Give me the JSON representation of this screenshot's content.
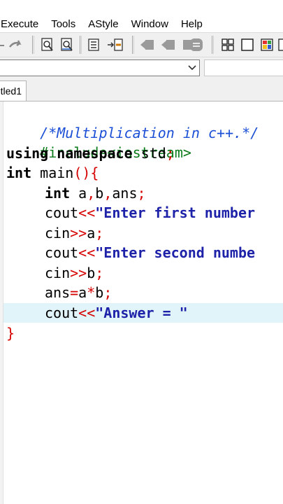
{
  "menu": [
    "Execute",
    "Tools",
    "AStyle",
    "Window",
    "Help"
  ],
  "combo": {
    "value": ""
  },
  "tab": {
    "label": "tled1"
  },
  "editor": {
    "line1": "/*Multiplication in c++.*/",
    "line2": "#include<iostream>",
    "line3_kw": "using namespace",
    "line3_rest": " std",
    "line3_semi": ";",
    "line4_kw": "int",
    "line4_rest": " main",
    "line4_ops": "(){",
    "line5_kw": "int",
    "line5_a": " a",
    "line5_c1": ",",
    "line5_b": "b",
    "line5_c2": ",",
    "line5_ans": "ans",
    "line5_semi": ";",
    "line6_cout": "cout",
    "line6_op": "<<",
    "line6_str": "\"Enter first number",
    "line7_cin": "cin",
    "line7_op": ">>",
    "line7_var": "a",
    "line7_semi": ";",
    "line8_cout": "cout",
    "line8_op": "<<",
    "line8_str": "\"Enter second numbe",
    "line9_cin": "cin",
    "line9_op": ">>",
    "line9_var": "b",
    "line9_semi": ";",
    "line10_ans": "ans",
    "line10_eq": "=",
    "line10_a": "a",
    "line10_mul": "*",
    "line10_b": "b",
    "line10_semi": ";",
    "line11_cout": "cout",
    "line11_op": "<<",
    "line11_str": "\"Answer = \"",
    "line12": "}"
  },
  "colors": {
    "comment": "#1b4fd6",
    "preprocessor": "#0a7a1a",
    "operator": "#d60000",
    "string": "#1d22a8",
    "active_line": "#e0f4fa"
  },
  "icons": [
    "redo-arrow-icon",
    "find-icon",
    "replace-icon",
    "indent-icon",
    "toggle-breakpoint-icon",
    "compile-icon",
    "run-icon",
    "compile-run-icon",
    "stop-icon",
    "new-project-icon",
    "class-icon",
    "module-icon",
    "properties-icon"
  ]
}
